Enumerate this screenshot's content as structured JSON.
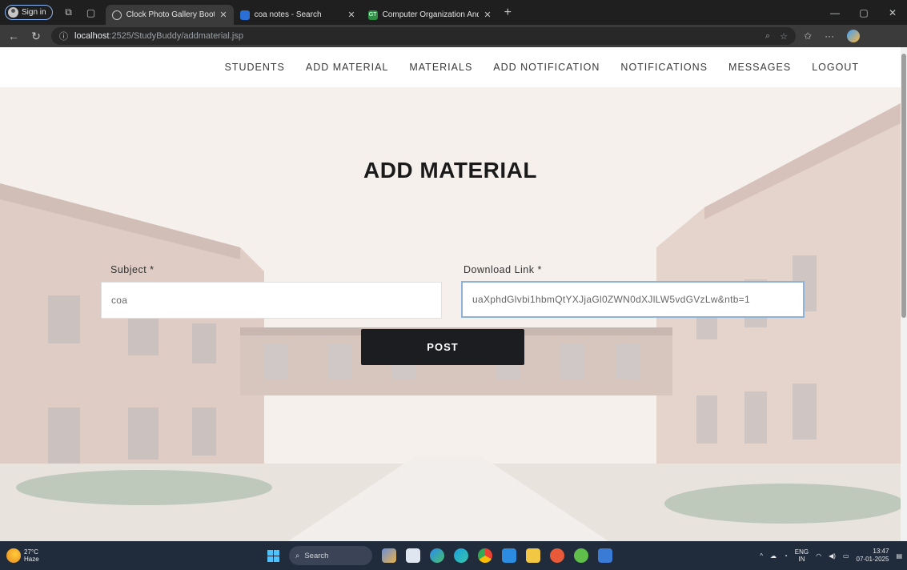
{
  "browser": {
    "profile_label": "Sign in",
    "tabs": [
      {
        "title": "Clock Photo Gallery Bootstrap Re",
        "favicon_color": "#7aa7d8",
        "active": true
      },
      {
        "title": "coa notes - Search",
        "favicon_color": "#2a6fd6",
        "active": false
      },
      {
        "title": "Computer Organization And Arc",
        "favicon_color": "#2f8d46",
        "favicon_text": "GT",
        "active": false
      }
    ],
    "new_tab_label": "+",
    "url_host": "localhost",
    "url_path": ":2525/StudyBuddy/addmaterial.jsp"
  },
  "nav": {
    "links": [
      "STUDENTS",
      "ADD MATERIAL",
      "MATERIALS",
      "ADD NOTIFICATION",
      "NOTIFICATIONS",
      "MESSAGES",
      "LOGOUT"
    ]
  },
  "form": {
    "title": "ADD MATERIAL",
    "subject_label": "Subject *",
    "subject_value": "coa",
    "link_label": "Download Link *",
    "link_value": "uaXphdGlvbi1hbmQtYXJjaGl0ZWN0dXJlLW5vdGVzLw&ntb=1",
    "submit_label": "POST"
  },
  "taskbar": {
    "weather_temp": "27°C",
    "weather_desc": "Haze",
    "search_label": "Search",
    "lang_top": "ENG",
    "lang_bottom": "IN",
    "time": "13:47",
    "date": "07-01-2025"
  },
  "colors": {
    "nav_text": "#3a3a3a",
    "button_bg": "#1c1d21",
    "focus_border": "#8fb3d6",
    "taskbar_bg": "#202b3c"
  }
}
